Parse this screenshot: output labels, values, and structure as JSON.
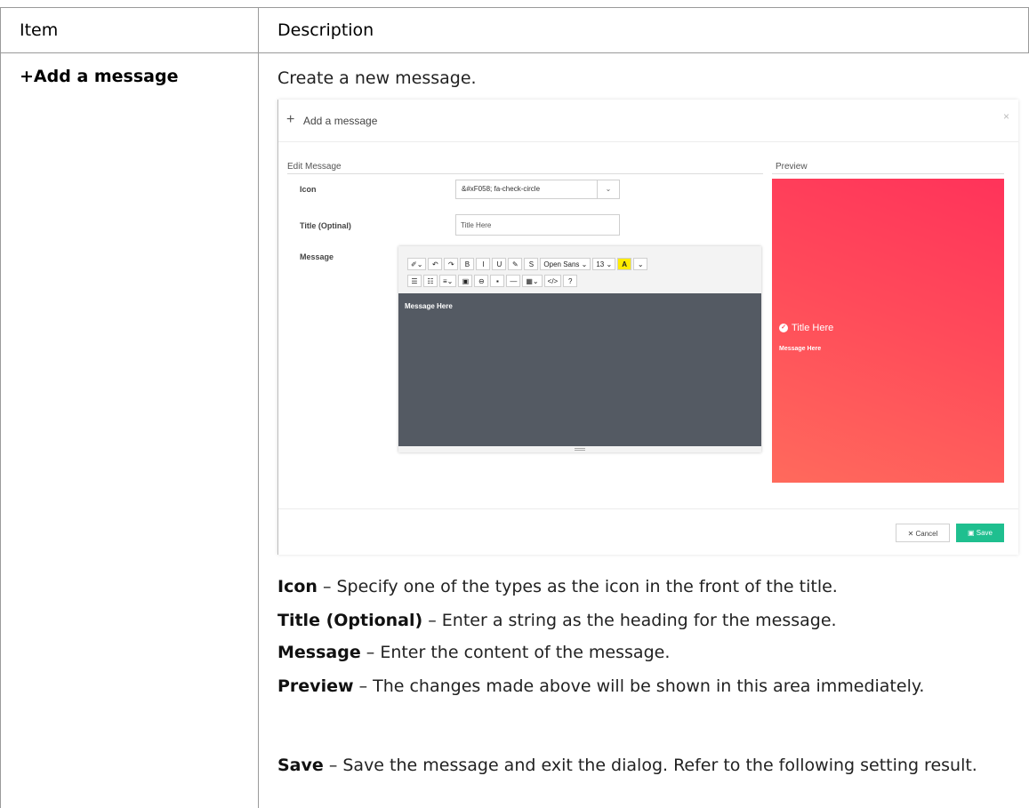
{
  "table": {
    "headers": {
      "item": "Item",
      "description": "Description"
    },
    "item": "+Add a message",
    "intro": "Create a new message.",
    "descriptions": [
      {
        "term": "Icon",
        "text": " – Specify one of the types as the icon in the front of the title."
      },
      {
        "term": "Title (Optional)",
        "text": " – Enter a string as the heading for the message."
      },
      {
        "term": "Message",
        "text": " – Enter the content of the message."
      },
      {
        "term": "Preview",
        "text": " – The changes made above will be shown in this area immediately."
      },
      {
        "term": "Save",
        "text": " – Save the message and exit the dialog. Refer to the following setting result."
      }
    ]
  },
  "dialog": {
    "title": "Add a message",
    "close": "×",
    "edit_section": "Edit Message",
    "preview_section": "Preview",
    "fields": {
      "icon_label": "Icon",
      "icon_value": "&#xF058; fa-check-circle",
      "title_label": "Title (Optinal)",
      "title_placeholder": "Title Here",
      "message_label": "Message"
    },
    "toolbar": {
      "row1": [
        "✐⌄",
        "↶",
        "↷",
        "B",
        "I",
        "U",
        "✎",
        "S",
        "Open Sans ⌄",
        "13 ⌄",
        "A",
        "⌄"
      ],
      "row2": [
        "☰",
        "☷",
        "≡⌄",
        "▣",
        "⊖",
        "▪",
        "—",
        "▦⌄",
        "</>",
        "?"
      ]
    },
    "editor_text": "Message Here",
    "preview": {
      "title": "Title Here",
      "message": "Message Here"
    },
    "buttons": {
      "cancel": "✕ Cancel",
      "save": "Save"
    },
    "colors": {
      "save_button": "#1fbf8f",
      "preview_gradient_top": "#ff335a",
      "preview_gradient_bottom": "#ff6a5c",
      "editor_bg": "#545a63"
    }
  }
}
